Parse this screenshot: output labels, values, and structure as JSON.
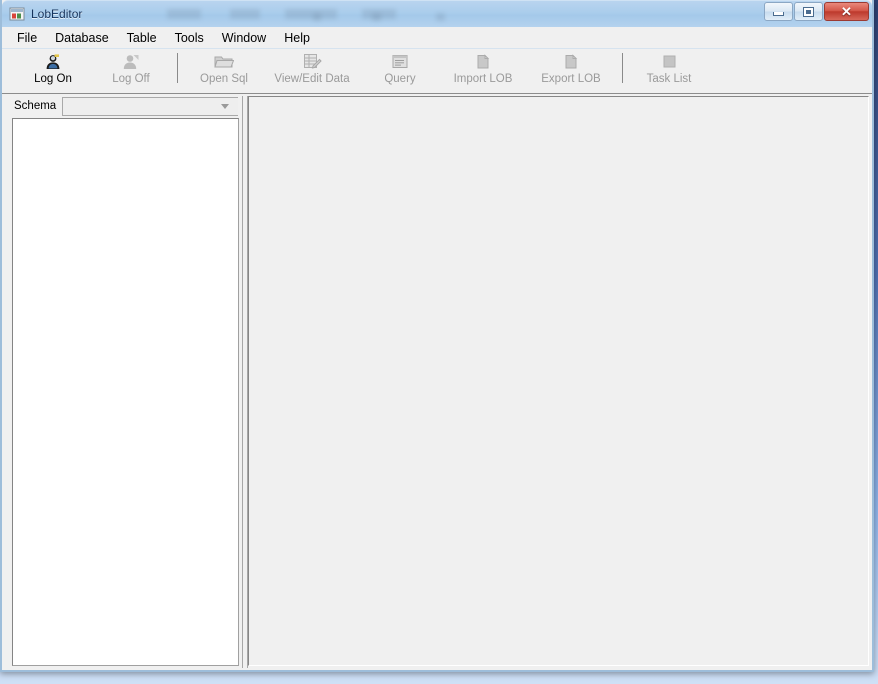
{
  "window": {
    "title": "LobEditor",
    "icon": "app-icon",
    "controls": {
      "minimize": "minimize",
      "maximize": "restore",
      "close": "✕"
    }
  },
  "menubar": {
    "items": [
      {
        "label": "File",
        "name": "menu-file"
      },
      {
        "label": "Database",
        "name": "menu-database"
      },
      {
        "label": "Table",
        "name": "menu-table"
      },
      {
        "label": "Tools",
        "name": "menu-tools"
      },
      {
        "label": "Window",
        "name": "menu-window"
      },
      {
        "label": "Help",
        "name": "menu-help"
      }
    ]
  },
  "toolbar": {
    "buttons": [
      {
        "label": "Log On",
        "icon": "user-head-icon",
        "enabled": true
      },
      {
        "label": "Log Off",
        "icon": "user-exit-icon",
        "enabled": false
      },
      {
        "label": "Open Sql",
        "icon": "folder-open-icon",
        "enabled": false
      },
      {
        "label": "View/Edit Data",
        "icon": "grid-edit-icon",
        "enabled": false
      },
      {
        "label": "Query",
        "icon": "query-window-icon",
        "enabled": false
      },
      {
        "label": "Import LOB",
        "icon": "import-file-icon",
        "enabled": false
      },
      {
        "label": "Export LOB",
        "icon": "export-file-icon",
        "enabled": false
      },
      {
        "label": "Task List",
        "icon": "task-list-icon",
        "enabled": false
      }
    ]
  },
  "sidebar": {
    "schema_label": "Schema",
    "schema_value": "",
    "schema_placeholder": "",
    "tree_items": []
  },
  "colors": {
    "title_bar": "#aacdec",
    "toolbar_bg": "#f0f0f0",
    "close_button": "#bd392c",
    "disabled_text": "#9a9a9a",
    "panel_white": "#ffffff",
    "desktop": "#4f6fb0"
  }
}
